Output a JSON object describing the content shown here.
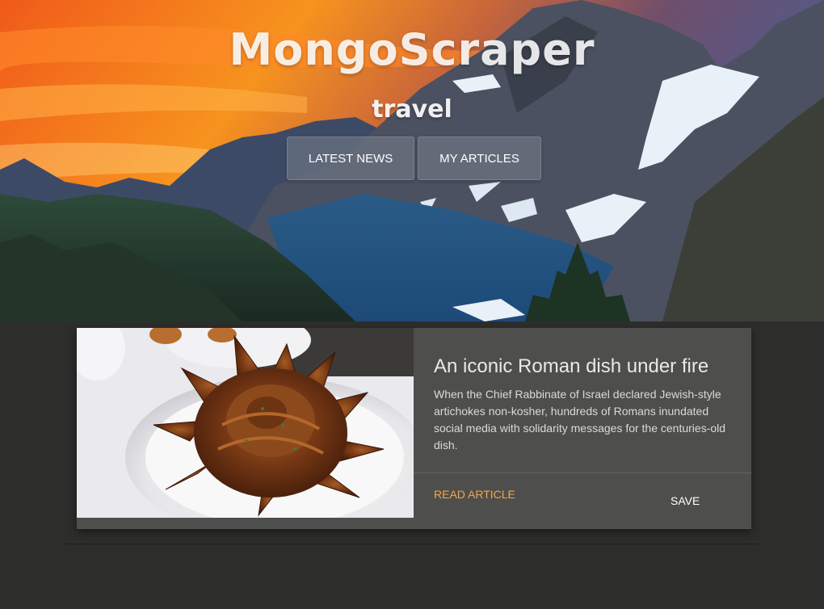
{
  "header": {
    "brand": "MongoScraper",
    "subtitle": "travel",
    "nav": {
      "latest_news": "LATEST NEWS",
      "my_articles": "MY ARTICLES"
    }
  },
  "article": {
    "title": "An iconic Roman dish under fire",
    "summary": "When the Chief Rabbinate of Israel declared Jewish-style artichokes non-kosher, hundreds of Romans inundated social media with solidarity messages for the centuries-old dish.",
    "read_label": "READ ARTICLE",
    "save_label": "SAVE"
  },
  "colors": {
    "page_background": "#2d2e2b",
    "card_background": "#4e4e4c",
    "accent_link": "#f2a64a"
  },
  "icons": {
    "hero_image": "mountain-sunset-image",
    "article_image": "fried-artichoke-image"
  }
}
